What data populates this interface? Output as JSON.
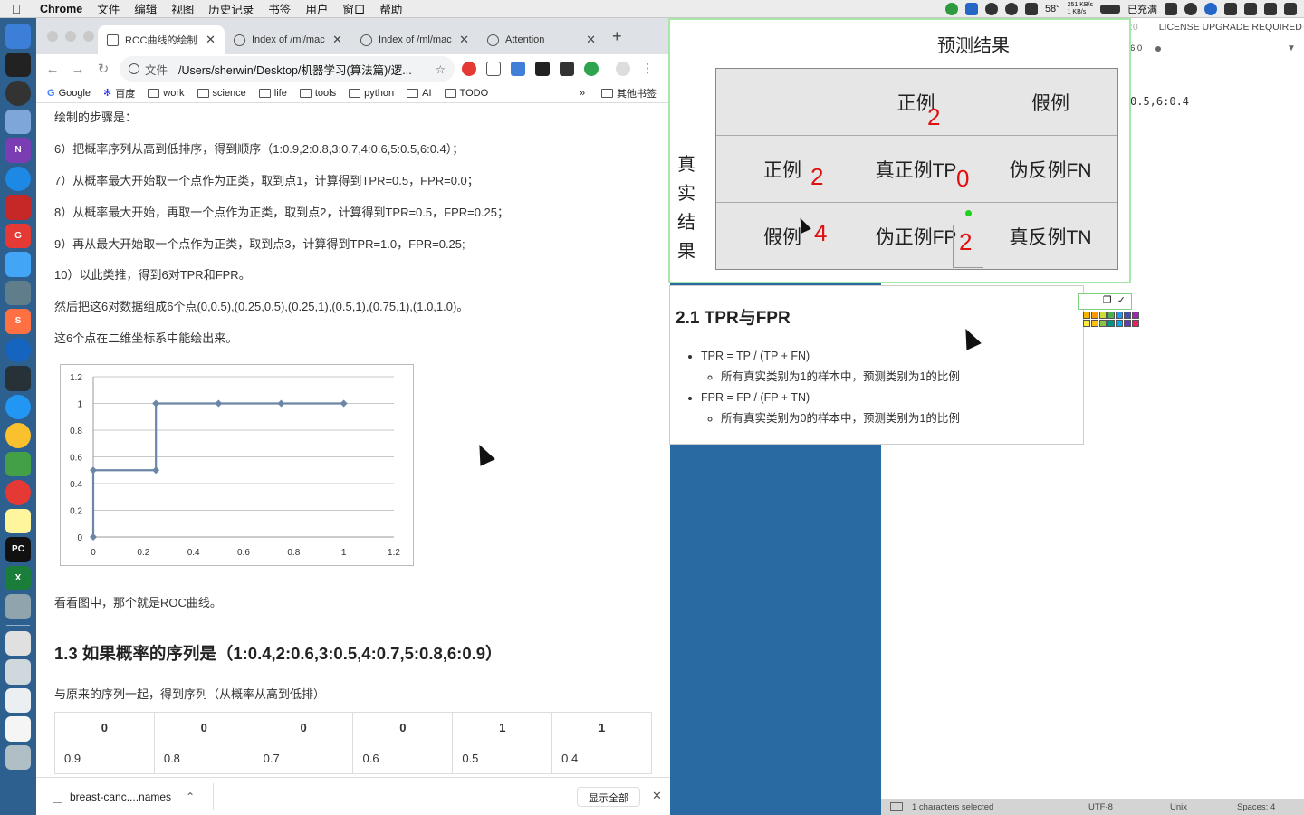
{
  "menubar": {
    "app": "Chrome",
    "items": [
      "文件",
      "编辑",
      "视图",
      "历史记录",
      "书签",
      "用户",
      "窗口",
      "帮助"
    ],
    "status": {
      "temp": "58°",
      "net_up": "251 KB/s",
      "net_down": "1 KB/s",
      "battery": "已充满"
    }
  },
  "tabs": [
    {
      "title": "ROC曲线的绘制 |",
      "active": true
    },
    {
      "title": "Index of /ml/mac",
      "active": false
    },
    {
      "title": "Index of /ml/mac",
      "active": false
    },
    {
      "title": "Attention",
      "active": false
    }
  ],
  "omnibox": {
    "scheme": "文件",
    "url": "/Users/sherwin/Desktop/机器学习(算法篇)/逻..."
  },
  "bookmarks": [
    "Google",
    "百度",
    "work",
    "science",
    "life",
    "tools",
    "python",
    "AI",
    "TODO"
  ],
  "bookmarks_more": "»",
  "bookmarks_other": "其他书签",
  "article": {
    "p0": "绘制的步骤是：",
    "p6": "6）把概率序列从高到低排序，得到顺序（1:0.9,2:0.8,3:0.7,4:0.6,5:0.5,6:0.4）；",
    "p7": "7）从概率最大开始取一个点作为正类，取到点1，计算得到TPR=0.5，FPR=0.0；",
    "p8": "8）从概率最大开始，再取一个点作为正类，取到点2，计算得到TPR=0.5，FPR=0.25；",
    "p9": "9）再从最大开始取一个点作为正类，取到点3，计算得到TPR=1.0，FPR=0.25;",
    "p10": "10）以此类推，得到6对TPR和FPR。",
    "p11": "然后把这6对数据组成6个点(0,0.5),(0.25,0.5),(0.25,1),(0.5,1),(0.75,1),(1.0,1.0)。",
    "p12": "这6个点在二维坐标系中能绘出来。",
    "p13": "看看图中，那个就是ROC曲线。",
    "h13": "1.3 如果概率的序列是（1:0.4,2:0.6,3:0.5,4:0.7,5:0.8,6:0.9）",
    "p14": "与原来的序列一起，得到序列（从概率从高到低排）"
  },
  "chart_data": {
    "type": "line",
    "x": [
      0,
      0,
      0.25,
      0.25,
      0.5,
      0.75,
      1.0
    ],
    "y": [
      0,
      0.5,
      0.5,
      1,
      1,
      1,
      1
    ],
    "xlim": [
      0,
      1.2
    ],
    "ylim": [
      0,
      1.2
    ],
    "xticks": [
      "0",
      "0.2",
      "0.4",
      "0.6",
      "0.8",
      "1",
      "1.2"
    ],
    "yticks": [
      "0",
      "0.2",
      "0.4",
      "0.6",
      "0.8",
      "1",
      "1.2"
    ],
    "grid": true,
    "color": "#6b86a6"
  },
  "prob_table": {
    "headers": [
      "0",
      "0",
      "0",
      "0",
      "1",
      "1"
    ],
    "row": [
      "0.9",
      "0.8",
      "0.7",
      "0.6",
      "0.5",
      "0.4"
    ]
  },
  "download": {
    "file": "breast-canc....names",
    "show_all": "显示全部"
  },
  "confusion": {
    "title": "预测结果",
    "row_title": [
      "真",
      "实",
      "结",
      "果"
    ],
    "col_pos": "正例",
    "col_neg": "假例",
    "row_pos": "正例",
    "row_neg": "假例",
    "tp": "真正例TP",
    "fn": "伪反例FN",
    "fp": "伪正例FP",
    "tn": "真反例TN",
    "n_pred_pos": "2",
    "n_actual_pos": "2",
    "n_actual_neg": "4",
    "tp_val": "0",
    "fp_val": "2"
  },
  "notes": {
    "title": "2.1 TPR与FPR",
    "tpr": "TPR = TP / (TP + FN)",
    "tpr_desc": "所有真实类别为1的样本中，预测类别为1的比例",
    "fpr": "FPR = FP / (FP + TN)",
    "fpr_desc": "所有真实类别为0的样本中，预测类别为1的比例"
  },
  "editor": {
    "license": "LICENSE UPGRADE REQUIRED",
    "tab_hint": ":0",
    "line_frag": "6:0",
    "code": "0.5,6:0.4",
    "status_sel": "1 characters selected",
    "status_enc": "UTF-8",
    "status_eol": "Unix",
    "status_spaces": "Spaces: 4"
  }
}
